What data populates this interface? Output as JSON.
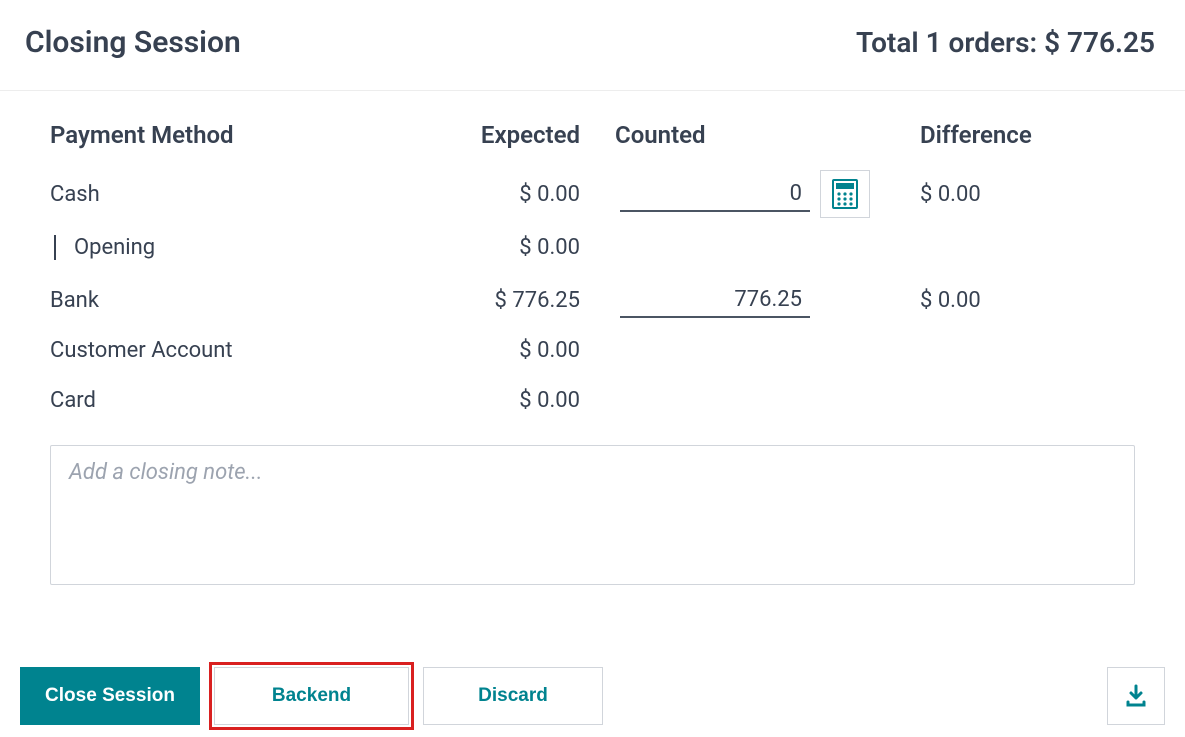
{
  "header": {
    "title": "Closing Session",
    "total_text": "Total 1 orders: $ 776.25"
  },
  "table": {
    "headers": {
      "method": "Payment Method",
      "expected": "Expected",
      "counted": "Counted",
      "difference": "Difference"
    },
    "rows": {
      "cash": {
        "label": "Cash",
        "expected": "$ 0.00",
        "counted": "0",
        "difference": "$ 0.00"
      },
      "opening": {
        "label": "Opening",
        "expected": "$ 0.00"
      },
      "bank": {
        "label": "Bank",
        "expected": "$ 776.25",
        "counted": "776.25",
        "difference": "$ 0.00"
      },
      "customer_account": {
        "label": "Customer Account",
        "expected": "$ 0.00"
      },
      "card": {
        "label": "Card",
        "expected": "$ 0.00"
      }
    }
  },
  "note": {
    "placeholder": "Add a closing note..."
  },
  "footer": {
    "close_session": "Close Session",
    "backend": "Backend",
    "discard": "Discard"
  }
}
